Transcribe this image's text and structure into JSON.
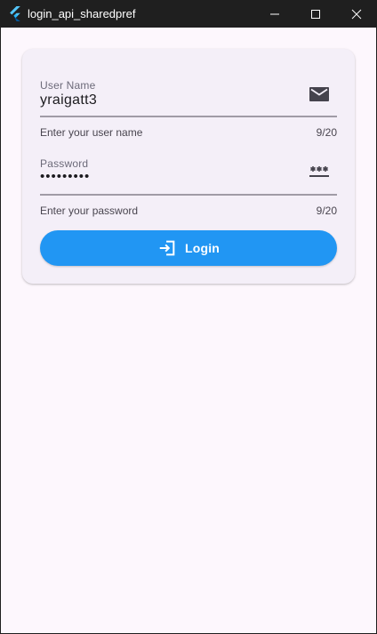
{
  "window": {
    "title": "login_api_sharedpref"
  },
  "form": {
    "username": {
      "label": "User Name",
      "value": "yraigatt3",
      "helper": "Enter your user name",
      "counter": "9/20",
      "icon": "email-icon"
    },
    "password": {
      "label": "Password",
      "value": "•••••••••",
      "helper": "Enter your password",
      "counter": "9/20",
      "icon": "password-icon"
    },
    "login_button": {
      "label": "Login",
      "icon": "login-icon",
      "color": "#2196f3"
    }
  },
  "colors": {
    "background": "#fdf7fd",
    "card": "#f4eff8",
    "accent": "#2196f3"
  }
}
